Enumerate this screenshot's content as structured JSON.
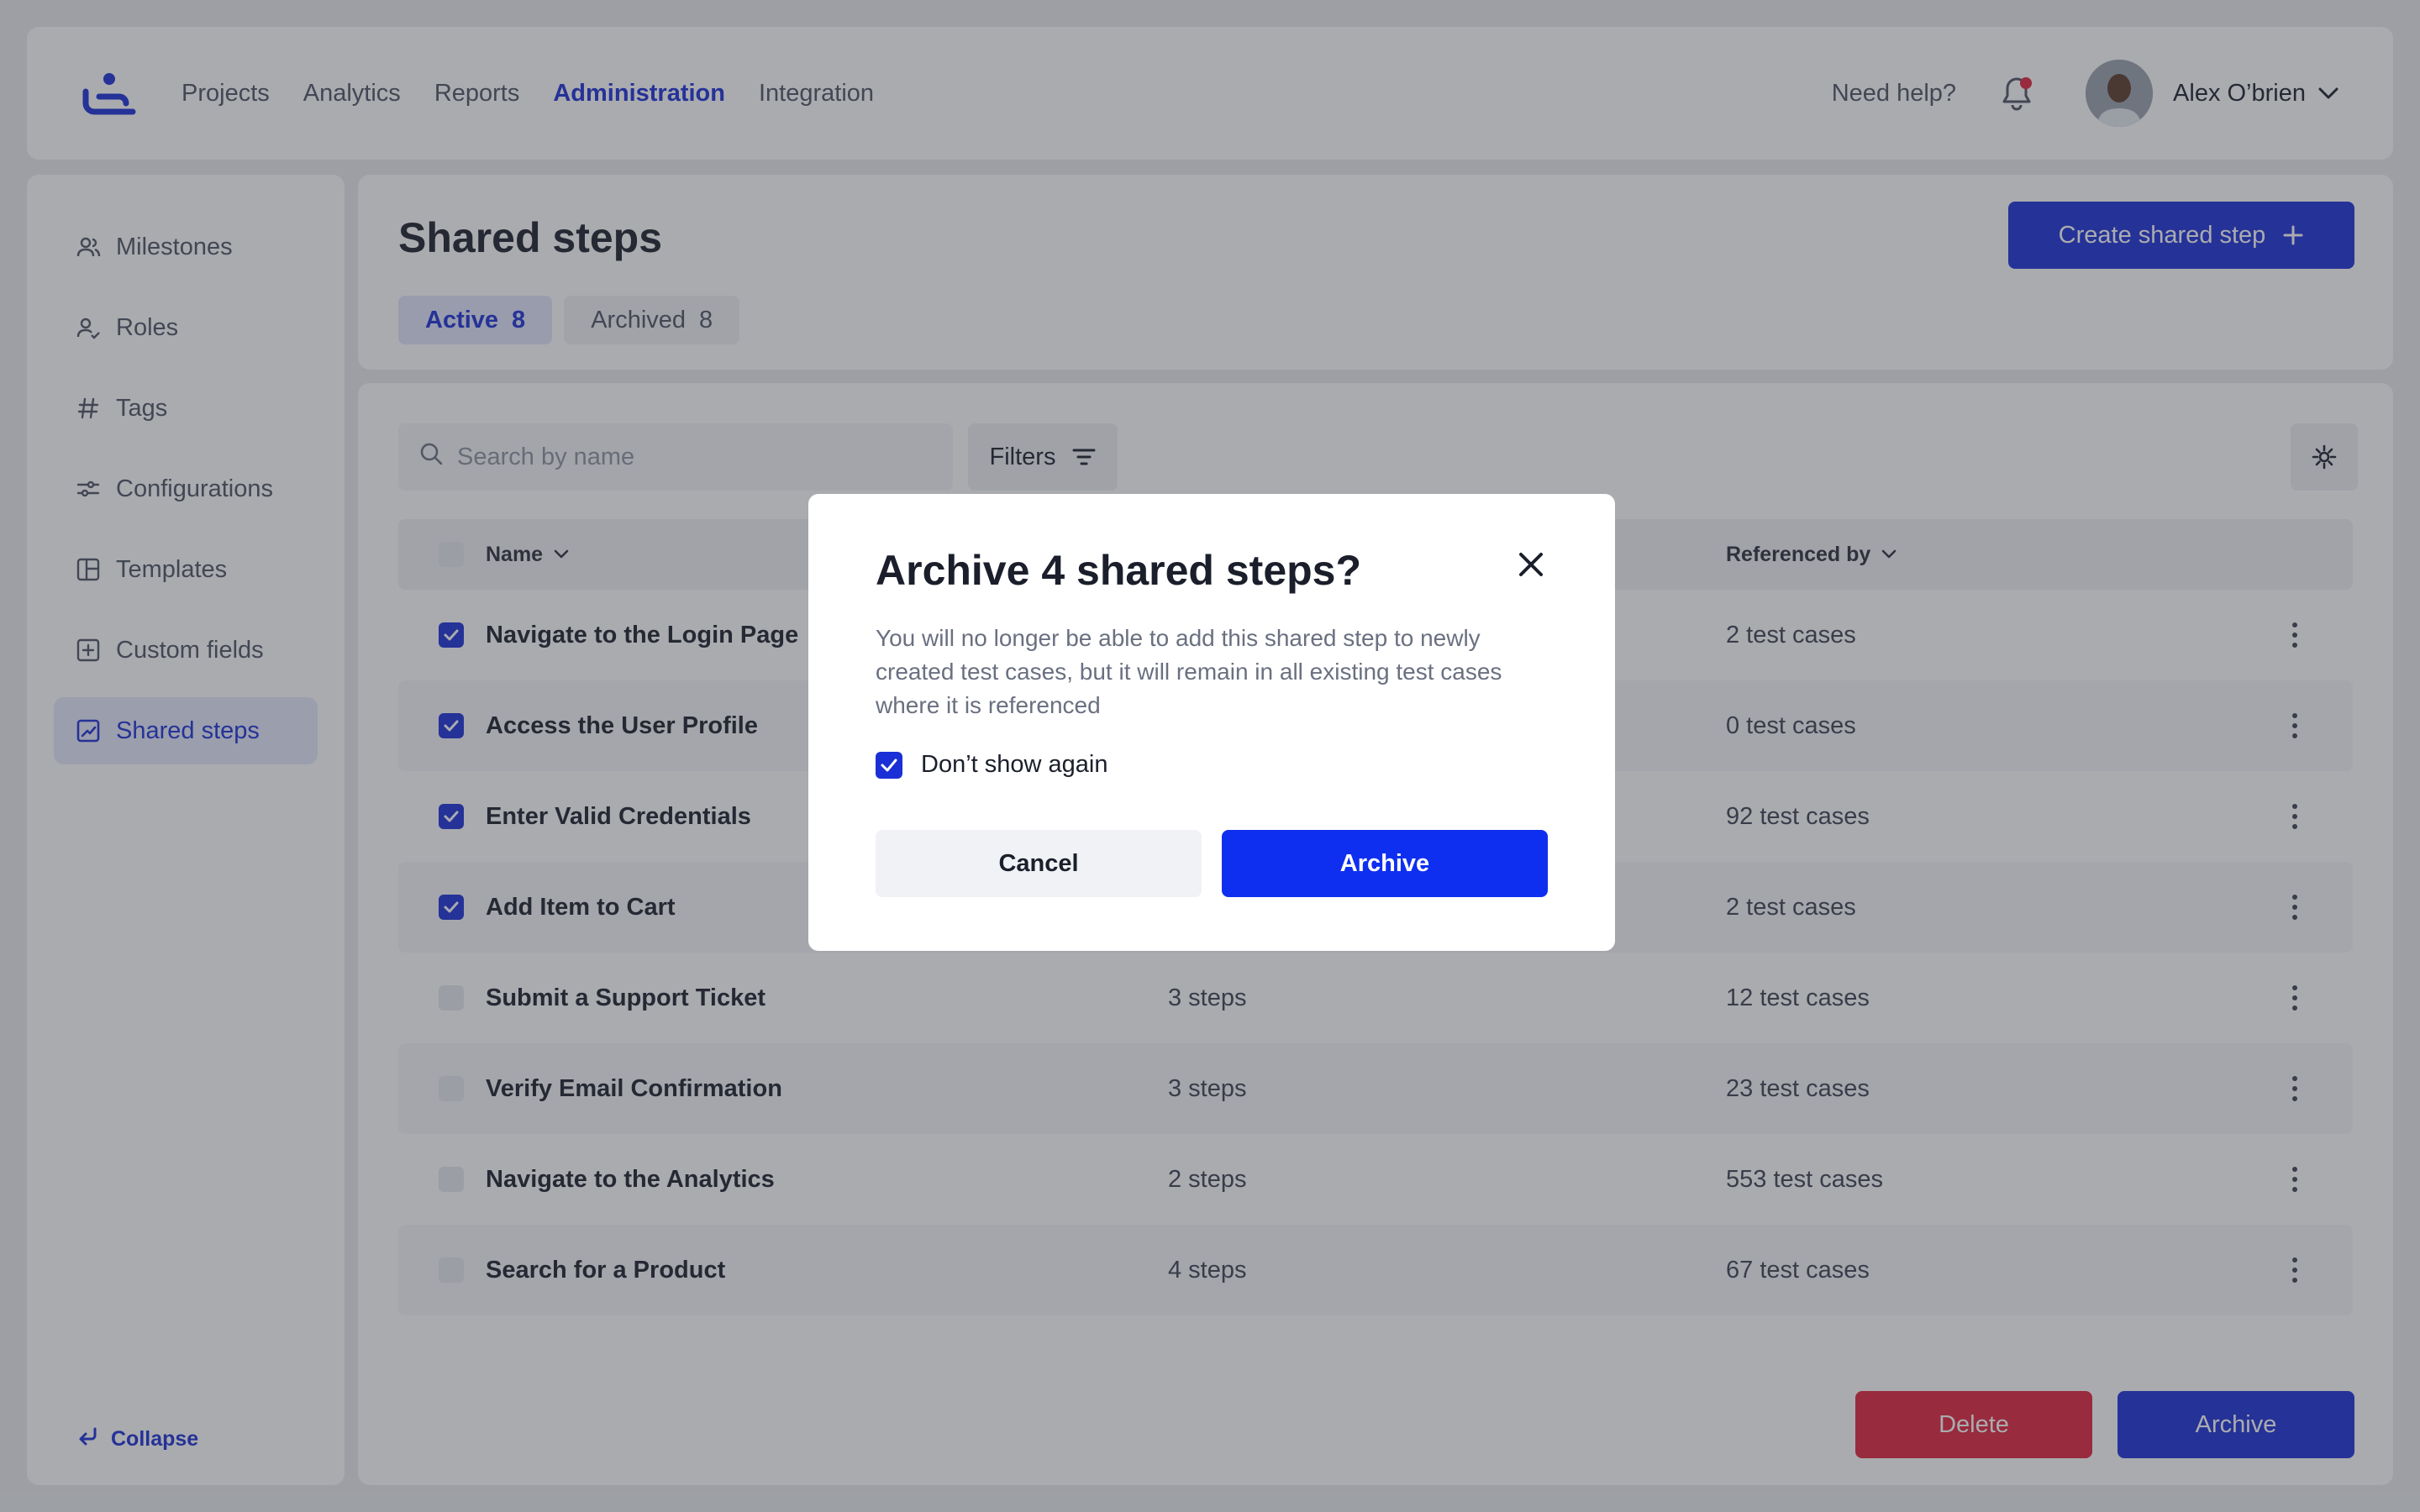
{
  "colors": {
    "accent": "#1a2fd6",
    "danger": "#e0233c",
    "modal_primary": "#0e2ff0"
  },
  "header": {
    "nav": [
      "Projects",
      "Analytics",
      "Reports",
      "Administration",
      "Integration"
    ],
    "active_nav": "Administration",
    "help": "Need help?",
    "user_name": "Alex O’brien"
  },
  "sidebar": {
    "items": [
      {
        "label": "Milestones",
        "icon": "users-icon"
      },
      {
        "label": "Roles",
        "icon": "user-role-icon"
      },
      {
        "label": "Tags",
        "icon": "hash-icon"
      },
      {
        "label": "Configurations",
        "icon": "sliders-icon"
      },
      {
        "label": "Templates",
        "icon": "layout-icon"
      },
      {
        "label": "Custom fields",
        "icon": "plus-square-icon"
      },
      {
        "label": "Shared steps",
        "icon": "chart-square-icon",
        "active": true
      }
    ],
    "collapse": "Collapse"
  },
  "page": {
    "title": "Shared steps",
    "create_button": "Create shared step",
    "tabs": [
      {
        "label": "Active",
        "count": "8",
        "active": true
      },
      {
        "label": "Archived",
        "count": "8"
      }
    ]
  },
  "toolbar": {
    "search_placeholder": "Search by name",
    "filters": "Filters"
  },
  "table": {
    "columns": {
      "name": "Name",
      "referenced": "Referenced by"
    },
    "rows": [
      {
        "name": "Navigate to the Login Page",
        "steps": "",
        "refs": "2 test cases",
        "checked": true
      },
      {
        "name": "Access the User Profile",
        "steps": "",
        "refs": "0 test cases",
        "checked": true
      },
      {
        "name": "Enter Valid Credentials",
        "steps": "",
        "refs": "92 test cases",
        "checked": true
      },
      {
        "name": "Add Item to Cart",
        "steps": "",
        "refs": "2 test cases",
        "checked": true
      },
      {
        "name": "Submit a Support Ticket",
        "steps": "3 steps",
        "refs": "12 test cases",
        "checked": false
      },
      {
        "name": "Verify Email Confirmation",
        "steps": "3 steps",
        "refs": "23 test cases",
        "checked": false
      },
      {
        "name": "Navigate to the Analytics",
        "steps": "2 steps",
        "refs": "553 test cases",
        "checked": false
      },
      {
        "name": "Search for a Product",
        "steps": "4 steps",
        "refs": "67 test cases",
        "checked": false
      }
    ]
  },
  "footer": {
    "delete": "Delete",
    "archive": "Archive"
  },
  "modal": {
    "title": "Archive 4 shared steps?",
    "description": "You will no longer be able to add this shared step to newly created test cases, but it will remain in all existing test cases where it is referenced",
    "checkbox_label": "Don’t show again",
    "checkbox_checked": true,
    "cancel": "Cancel",
    "confirm": "Archive"
  }
}
